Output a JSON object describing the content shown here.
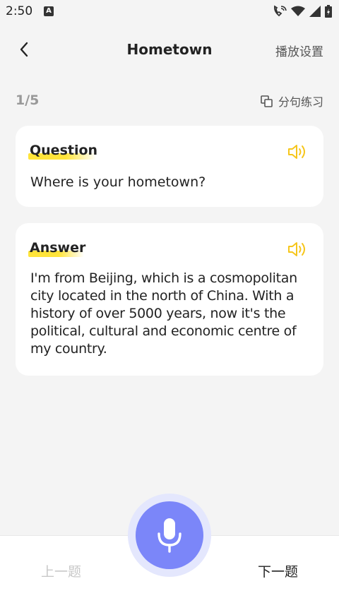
{
  "status_bar": {
    "time": "2:50",
    "badge": "A",
    "icons": [
      "call-wifi-icon",
      "wifi-icon",
      "signal-icon",
      "battery-charging-icon"
    ]
  },
  "nav": {
    "title": "Hometown",
    "settings_label": "播放设置",
    "back_icon": "chevron-left-icon"
  },
  "progress": {
    "text": "1/5",
    "split_label": "分句练习",
    "split_icon": "copy-icon"
  },
  "question": {
    "label": "Question",
    "text": "Where is your hometown?",
    "speaker_icon": "speaker-icon"
  },
  "answer": {
    "label": "Answer",
    "text": "I'm from Beijing, which is a cosmopolitan city located in the north of China. With a history of over 5000 years, now it's the political, cultural and economic centre of my country.",
    "speaker_icon": "speaker-icon"
  },
  "bottom": {
    "prev_label": "上一题",
    "next_label": "下一题",
    "mic_icon": "microphone-icon"
  },
  "colors": {
    "accent_yellow": "#ffd93a",
    "mic_blue": "#7b86f9",
    "mic_halo": "#e4e7fd",
    "background": "#f4f4f4"
  }
}
